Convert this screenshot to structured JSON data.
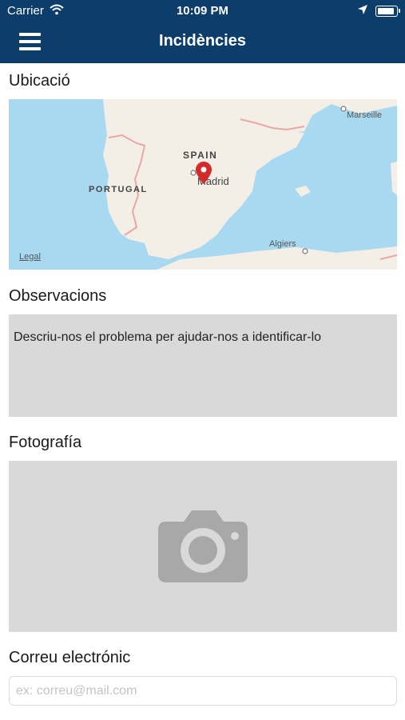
{
  "status_bar": {
    "carrier": "Carrier",
    "time": "10:09 PM"
  },
  "nav": {
    "title": "Incidències",
    "menu_icon": "hamburger-menu-icon"
  },
  "location": {
    "label": "Ubicació",
    "map_labels": {
      "country_spain": "SPAIN",
      "country_portugal": "PORTUGAL",
      "city_madrid": "Madrid",
      "city_marseille": "Marseille",
      "city_algiers": "Algiers",
      "legal": "Legal"
    }
  },
  "observations": {
    "label": "Observacions",
    "placeholder": "Descriu-nos el problema per ajudar-nos a identificar-lo"
  },
  "photo": {
    "label": "Fotografía",
    "icon": "camera-icon"
  },
  "email": {
    "label": "Correu electrónic",
    "placeholder": "ex: correu@mail.com"
  },
  "colors": {
    "nav_background": "#0d3d6b",
    "field_background": "#d9d9d9",
    "sea": "#a9d9f0",
    "land": "#f4efe6"
  }
}
